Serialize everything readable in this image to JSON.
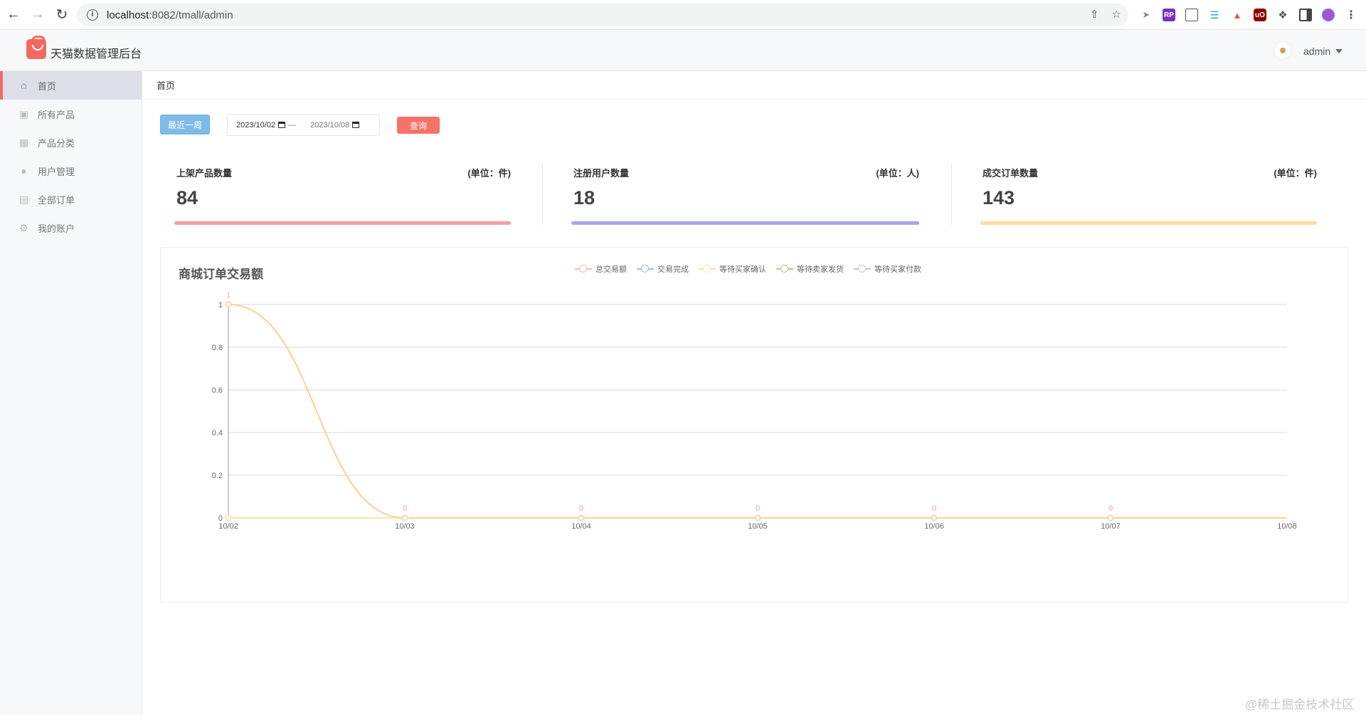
{
  "browser": {
    "url_host": "localhost",
    "url_path": ":8082/tmall/admin"
  },
  "header": {
    "title": "天猫数据管理后台",
    "user": "admin"
  },
  "sidebar": {
    "items": [
      {
        "label": "首页",
        "icon": "home-icon",
        "active": true
      },
      {
        "label": "所有产品",
        "icon": "product-icon",
        "active": false
      },
      {
        "label": "产品分类",
        "icon": "grid-icon",
        "active": false
      },
      {
        "label": "用户管理",
        "icon": "user-icon",
        "active": false
      },
      {
        "label": "全部订单",
        "icon": "order-icon",
        "active": false
      },
      {
        "label": "我的账户",
        "icon": "gear-icon",
        "active": false
      }
    ]
  },
  "breadcrumb": "首页",
  "filter": {
    "week_label": "最近一周",
    "start_date": "2023/10/02",
    "end_date": "2023/10/08",
    "separator": "—",
    "query_label": "查询"
  },
  "stats": [
    {
      "label": "上架产品数量",
      "unit": "(单位：件)",
      "value": "84",
      "color": "#f2a0a0"
    },
    {
      "label": "注册用户数量",
      "unit": "(单位：人)",
      "value": "18",
      "color": "#a6a8e8"
    },
    {
      "label": "成交订单数量",
      "unit": "(单位：件)",
      "value": "143",
      "color": "#fbdca0"
    }
  ],
  "chart": {
    "title": "商城订单交易额"
  },
  "chart_data": {
    "type": "line",
    "categories": [
      "10/02",
      "10/03",
      "10/04",
      "10/05",
      "10/06",
      "10/07",
      "10/08"
    ],
    "ylim": [
      0,
      1
    ],
    "yticks": [
      "0",
      "0.2",
      "0.4",
      "0.6",
      "0.8",
      "1"
    ],
    "grid": true,
    "legend_position": "top-center",
    "smooth": true,
    "series": [
      {
        "name": "总交易额",
        "color": "#f5b7b7",
        "values": [
          1,
          0,
          0,
          0,
          0,
          0,
          0
        ],
        "show_labels": true
      },
      {
        "name": "交易完成",
        "color": "#a9b8e0",
        "values": [
          0,
          0,
          0,
          0,
          0,
          0,
          0
        ],
        "show_labels": false
      },
      {
        "name": "等待买家确认",
        "color": "#f8e4a6",
        "values": [
          0,
          0,
          0,
          0,
          0,
          0,
          0
        ],
        "show_labels": false
      },
      {
        "name": "等待卖家发货",
        "color": "#b5c3a0",
        "values": [
          0,
          0,
          0,
          0,
          0,
          0,
          0
        ],
        "show_labels": false
      },
      {
        "name": "等待买家付款",
        "color": "#c7c7c7",
        "values": [
          0,
          0,
          0,
          0,
          0,
          0,
          0
        ],
        "show_labels": false
      }
    ]
  },
  "watermark": "@稀土掘金技术社区"
}
